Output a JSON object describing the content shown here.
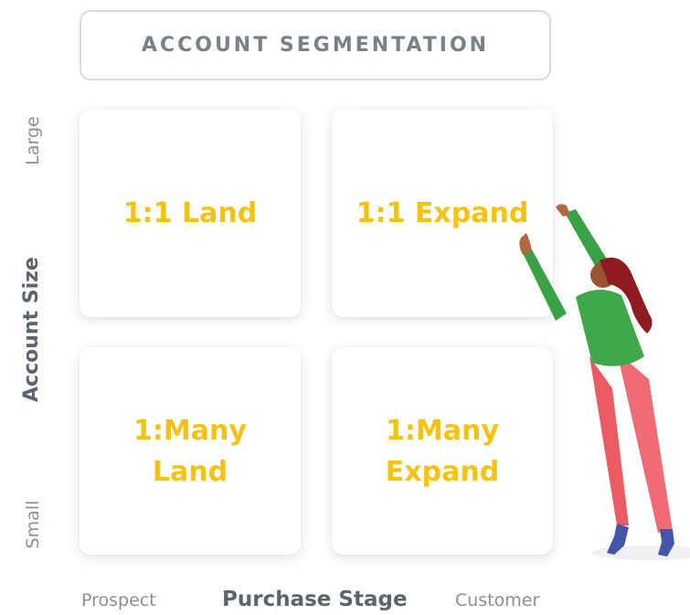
{
  "title": "ACCOUNT SEGMENTATION",
  "y_axis": {
    "title": "Account Size",
    "top_label": "Large",
    "bottom_label": "Small"
  },
  "x_axis": {
    "title": "Purchase Stage",
    "left_label": "Prospect",
    "right_label": "Customer"
  },
  "quadrants": {
    "top_left": "1:1 Land",
    "top_right": "1:1 Expand",
    "bottom_left": "1:Many\nLand",
    "bottom_right": "1:Many\nExpand"
  },
  "colors": {
    "accent": "#f5c30f",
    "axis_title": "#5c6470",
    "axis_label": "#8a8f97",
    "box_border": "#d7d9dd"
  },
  "illustration": "woman-pointing-icon"
}
